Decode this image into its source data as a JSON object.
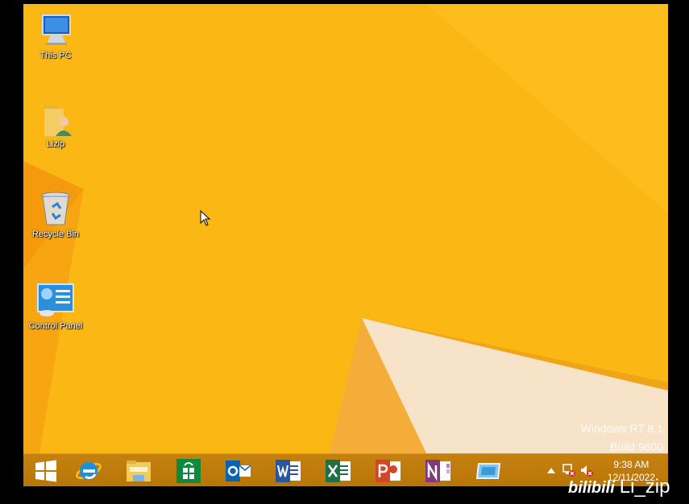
{
  "desktop": {
    "icons": [
      {
        "label": "This PC",
        "icon": "computer-icon"
      },
      {
        "label": "Lizip",
        "icon": "user-folder-icon"
      },
      {
        "label": "Recycle Bin",
        "icon": "recycle-bin-icon"
      },
      {
        "label": "Control Panel",
        "icon": "control-panel-icon"
      }
    ],
    "wallpaper_colors": {
      "main": "#fbb814",
      "dark": "#f5a00c",
      "light_shape": "#f6e3c8"
    }
  },
  "watermark": {
    "line1": "Windows RT 8.1",
    "line2": "Build 9600"
  },
  "taskbar": {
    "start_button": "start-icon",
    "pinned": [
      "internet-explorer-icon",
      "file-explorer-icon",
      "store-icon",
      "outlook-icon",
      "word-icon",
      "excel-icon",
      "powerpoint-icon",
      "onenote-icon",
      "remote-desktop-icon"
    ],
    "tray": {
      "time": "9:38 AM",
      "date": "12/11/2022"
    }
  },
  "overlay": {
    "brand": "bilibili",
    "user": "Li_zip"
  },
  "colors": {
    "taskbar": "#c07c0c",
    "accent": "#fbb814"
  }
}
